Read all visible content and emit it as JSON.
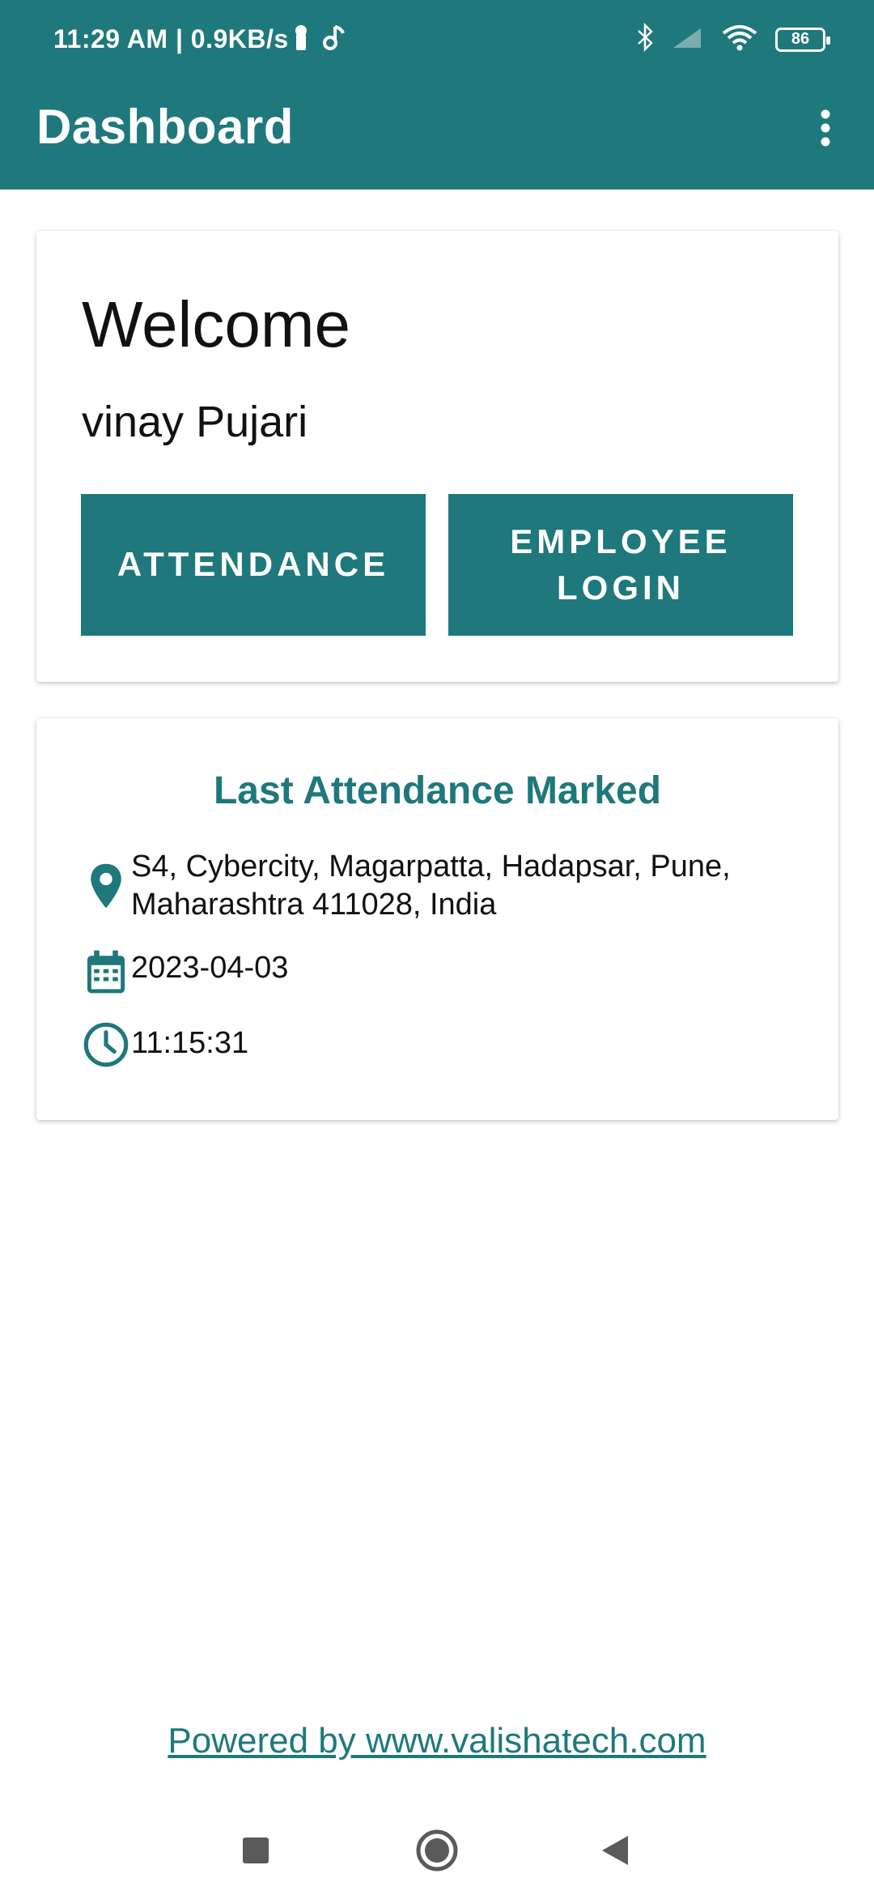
{
  "status_bar": {
    "time_speed": "11:29 AM | 0.9KB/s",
    "battery": "86",
    "icons_left": [
      "key-icon",
      "music-note-icon"
    ],
    "icons_right": [
      "bluetooth-icon",
      "signal-icon",
      "wifi-icon",
      "battery-icon"
    ]
  },
  "toolbar": {
    "title": "Dashboard",
    "menu_icon": "more-vert-icon"
  },
  "welcome_card": {
    "title": "Welcome",
    "user_name": "vinay Pujari",
    "attendance_button": "ATTENDANCE",
    "employee_login_button": "EMPLOYEE LOGIN"
  },
  "last_attendance": {
    "title": "Last Attendance Marked",
    "address": "S4, Cybercity, Magarpatta, Hadapsar, Pune, Maharashtra 411028, India",
    "date": "2023-04-03",
    "time": "11:15:31",
    "icons": [
      "location-pin-icon",
      "calendar-icon",
      "clock-icon"
    ]
  },
  "footer": {
    "powered_by": "Powered by www.valishatech.com"
  },
  "navigation": {
    "buttons": [
      "recent-apps-icon",
      "home-icon",
      "back-icon"
    ]
  },
  "colors": {
    "primary": "#1f787c",
    "text": "#111111",
    "background": "#ffffff"
  }
}
